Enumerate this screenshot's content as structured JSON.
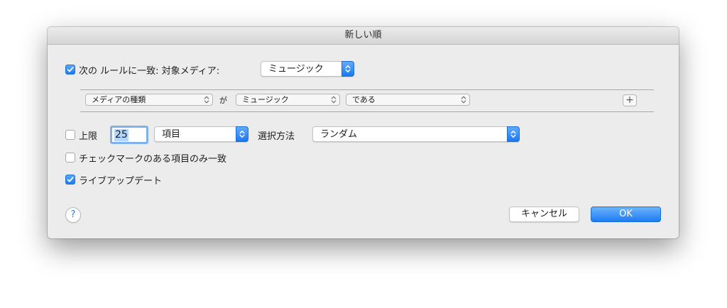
{
  "window": {
    "title": "新しい順"
  },
  "match_rules": {
    "checked": true,
    "label": "次の ルールに一致: 対象メディア:",
    "media_popup_value": "ミュージック"
  },
  "rule": {
    "field": "メディアの種類",
    "connector": "が",
    "value": "ミュージック",
    "operator": "である",
    "add_label": "+"
  },
  "limit": {
    "checked": false,
    "label": "上限",
    "value": "25",
    "unit": "項目",
    "selection_label": "選択方法",
    "selection_value": "ランダム"
  },
  "checked_items_only": {
    "checked": false,
    "label": "チェックマークのある項目のみ一致"
  },
  "live_updating": {
    "checked": true,
    "label": "ライブアップデート"
  },
  "buttons": {
    "help": "?",
    "cancel": "キャンセル",
    "ok": "OK"
  },
  "colors": {
    "accent": "#1d7cf2",
    "dialog_bg": "#ececec"
  }
}
